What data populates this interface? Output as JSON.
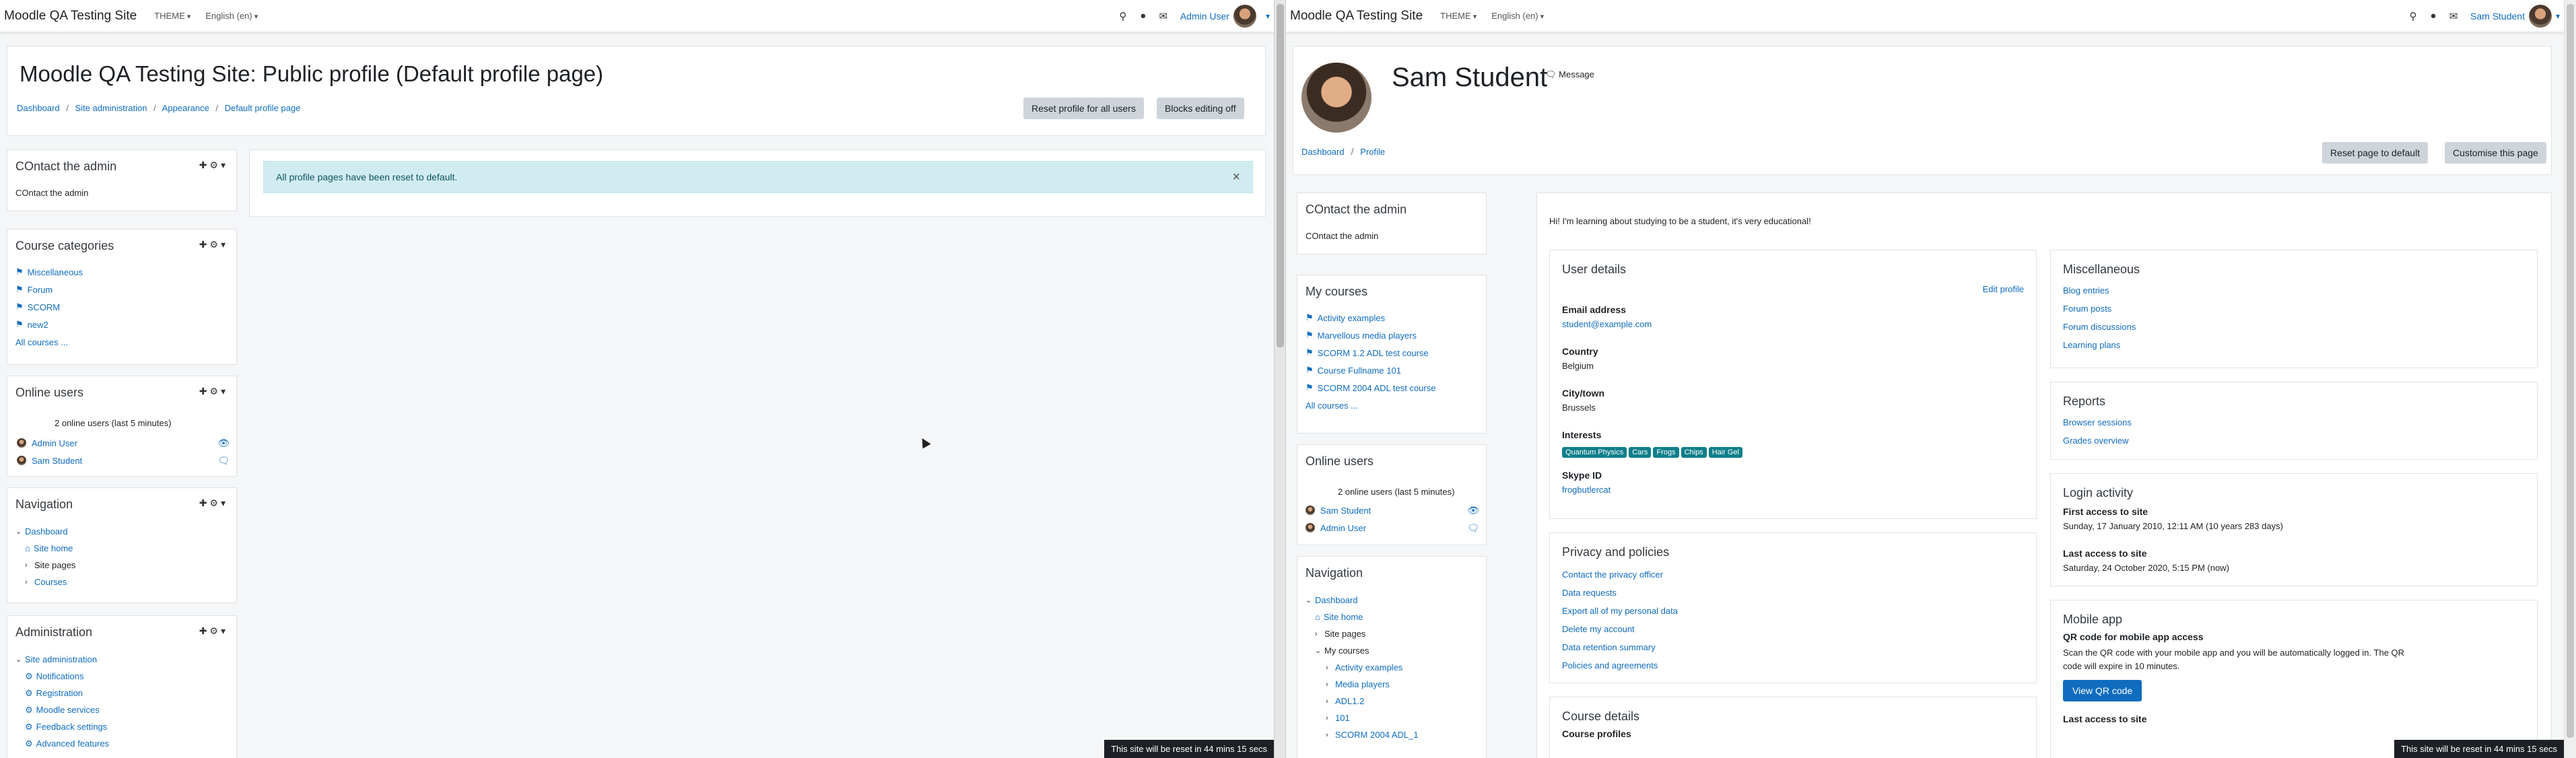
{
  "left": {
    "navbar": {
      "brand": "Moodle QA Testing Site",
      "menu1": "THEME",
      "menu2": "English (en)",
      "user": "Admin User"
    },
    "heading": "Moodle QA Testing Site: Public profile (Default profile page)",
    "breadcrumb": [
      "Dashboard",
      "Site administration",
      "Appearance",
      "Default profile page"
    ],
    "buttons": {
      "reset": "Reset profile for all users",
      "editing": "Blocks editing off"
    },
    "alert": "All profile pages have been reset to default.",
    "contact": {
      "title": "COntact the admin",
      "text": "COntact the admin"
    },
    "categories": {
      "title": "Course categories",
      "items": [
        "Miscellaneous",
        "Forum",
        "SCORM",
        "new2"
      ],
      "all": "All courses ..."
    },
    "online": {
      "title": "Online users",
      "summary": "2 online users (last 5 minutes)",
      "users": [
        "Admin User",
        "Sam Student"
      ]
    },
    "navigation": {
      "title": "Navigation",
      "dashboard": "Dashboard",
      "site_home": "Site home",
      "site_pages": "Site pages",
      "courses": "Courses"
    },
    "admin": {
      "title": "Administration",
      "site_admin": "Site administration",
      "items": [
        "Notifications",
        "Registration",
        "Moodle services",
        "Feedback settings",
        "Advanced features"
      ]
    },
    "footer": "This site will be reset in 44 mins 15 secs"
  },
  "right": {
    "navbar": {
      "brand": "Moodle QA Testing Site",
      "menu1": "THEME",
      "menu2": "English (en)",
      "user": "Sam Student"
    },
    "name": "Sam Student",
    "message": "Message",
    "breadcrumb": [
      "Dashboard",
      "Profile"
    ],
    "buttons": {
      "reset": "Reset page to default",
      "customise": "Customise this page",
      "qr": "View QR code"
    },
    "contact": {
      "title": "COntact the admin",
      "text": "COntact the admin"
    },
    "mycourses": {
      "title": "My courses",
      "items": [
        "Activity examples",
        "Marvellous media players",
        "SCORM 1.2 ADL test course",
        "Course Fullname 101",
        "SCORM 2004 ADL test course"
      ],
      "all": "All courses ..."
    },
    "online": {
      "title": "Online users",
      "summary": "2 online users (last 5 minutes)",
      "users": [
        "Sam Student",
        "Admin User"
      ]
    },
    "navigation": {
      "title": "Navigation",
      "dashboard": "Dashboard",
      "site_home": "Site home",
      "site_pages": "Site pages",
      "my_courses": "My courses",
      "courses": [
        "Activity examples",
        "Media players",
        "ADL1.2",
        "101",
        "SCORM 2004 ADL_1"
      ]
    },
    "description": "Hi! I'm learning about studying to be a student, it's very educational!",
    "user_details": {
      "title": "User details",
      "edit": "Edit profile",
      "email_label": "Email address",
      "email": "student@example.com",
      "country_label": "Country",
      "country": "Belgium",
      "city_label": "City/town",
      "city": "Brussels",
      "interests_label": "Interests",
      "interests": [
        "Quantum Physics",
        "Cars",
        "Frogs",
        "Chips",
        "Hair Gel"
      ],
      "skype_label": "Skype ID",
      "skype": "frogbutlercat"
    },
    "privacy": {
      "title": "Privacy and policies",
      "items": [
        "Contact the privacy officer",
        "Data requests",
        "Export all of my personal data",
        "Delete my account",
        "Data retention summary",
        "Policies and agreements"
      ]
    },
    "course_details": {
      "title": "Course details",
      "profiles": "Course profiles"
    },
    "misc": {
      "title": "Miscellaneous",
      "items": [
        "Blog entries",
        "Forum posts",
        "Forum discussions",
        "Learning plans"
      ]
    },
    "reports": {
      "title": "Reports",
      "items": [
        "Browser sessions",
        "Grades overview"
      ]
    },
    "login": {
      "title": "Login activity",
      "first_label": "First access to site",
      "first": "Sunday, 17 January 2010, 12:11 AM  (10 years 283 days)",
      "last_label": "Last access to site",
      "last": "Saturday, 24 October 2020, 5:15 PM  (now)"
    },
    "mobile": {
      "title": "Mobile app",
      "qr_label": "QR code for mobile app access",
      "qr_text": "Scan the QR code with your mobile app and you will be automatically logged in. The QR code will expire in 10 minutes.",
      "last_label": "Last access to site"
    },
    "footer": "This site will be reset in 44 mins 15 secs"
  }
}
